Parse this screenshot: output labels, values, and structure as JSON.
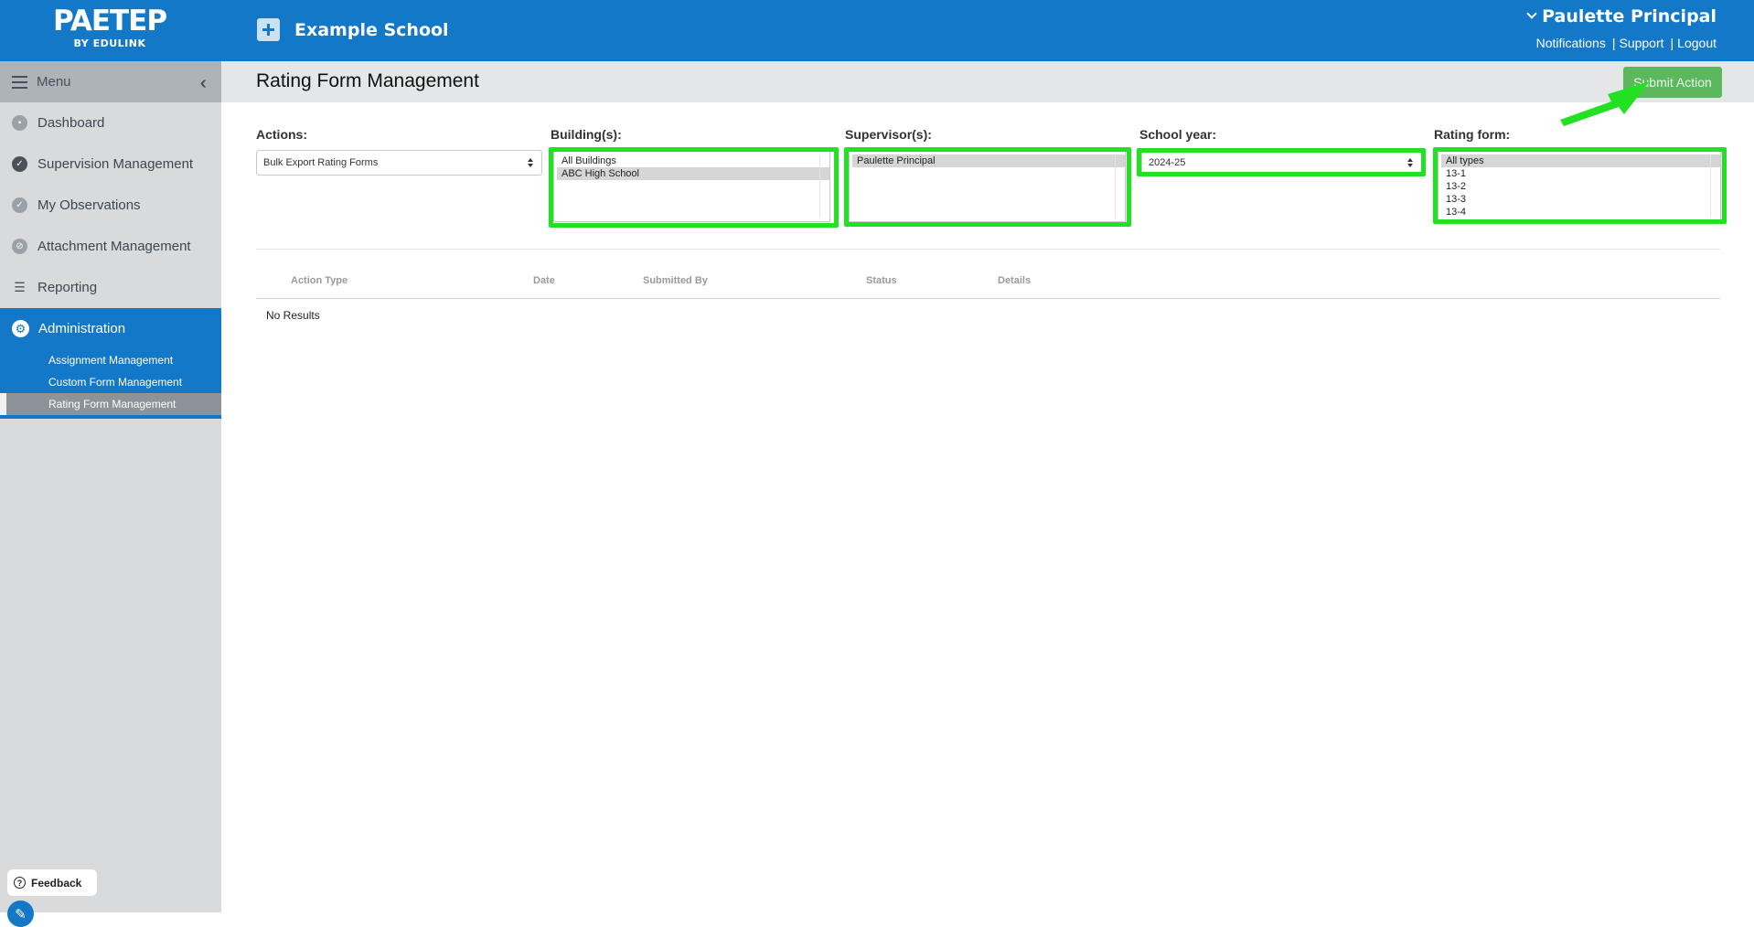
{
  "header": {
    "brand": "PAETEP",
    "brand_sub": "BY EDULINK",
    "school_name": "Example School",
    "user_name": "Paulette Principal",
    "links": [
      "Notifications",
      "Support",
      "Logout"
    ]
  },
  "sidebar": {
    "menu_label": "Menu",
    "items": [
      {
        "label": "Dashboard",
        "icon": "dashboard-icon"
      },
      {
        "label": "Supervision Management",
        "icon": "check-circle-icon"
      },
      {
        "label": "My Observations",
        "icon": "checkmark-icon"
      },
      {
        "label": "Attachment Management",
        "icon": "paperclip-icon"
      },
      {
        "label": "Reporting",
        "icon": "report-icon"
      }
    ],
    "admin": {
      "label": "Administration",
      "subitems": [
        "Assignment Management",
        "Custom Form Management",
        "Rating Form Management"
      ],
      "active": "Rating Form Management"
    },
    "feedback_label": "Feedback"
  },
  "page": {
    "title": "Rating Form Management",
    "submit_label": "Submit Action"
  },
  "filters": {
    "actions": {
      "label": "Actions:",
      "value": "Bulk Export Rating Forms"
    },
    "buildings": {
      "label": "Building(s):",
      "options": [
        "All Buildings",
        "ABC High School"
      ],
      "selected": "ABC High School"
    },
    "supervisors": {
      "label": "Supervisor(s):",
      "options": [
        "Paulette Principal"
      ],
      "selected": "Paulette Principal"
    },
    "school_year": {
      "label": "School year:",
      "value": "2024-25"
    },
    "rating_form": {
      "label": "Rating form:",
      "options": [
        "All types",
        "13-1",
        "13-2",
        "13-3",
        "13-4"
      ],
      "selected": "All types"
    }
  },
  "table": {
    "columns": [
      "Action Type",
      "Date",
      "Submitted By",
      "Status",
      "Details"
    ],
    "empty_text": "No Results"
  },
  "annotation": {
    "highlight_color": "#22e022"
  }
}
